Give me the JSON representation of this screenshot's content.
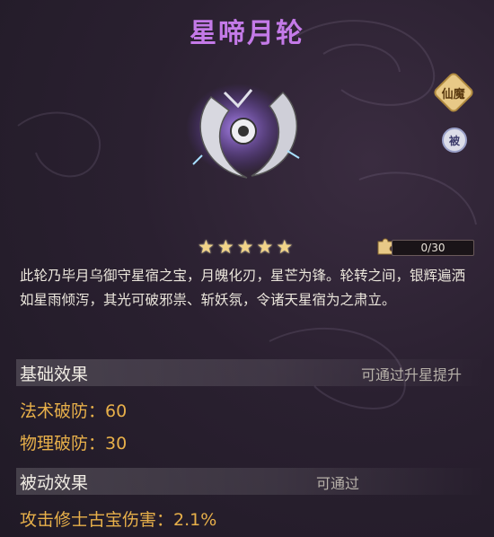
{
  "item": {
    "name": "星啼月轮",
    "tag_type": "仙魔",
    "tag_passive": "被",
    "stars": 5,
    "shards": "0/30",
    "description": "此轮乃毕月乌御守星宿之宝，月魄化刃，星芒为锋。轮转之间，银辉遍洒如星雨倾泻，其光可破邪祟、斩妖氛，令诸天星宿为之肃立。"
  },
  "base_section": {
    "title": "基础效果",
    "hint": "可通过升星提升",
    "stats": [
      "法术破防：60",
      "物理破防：30"
    ]
  },
  "passive_section": {
    "title": "被动效果",
    "hint": "可通过",
    "stats": [
      "攻击修士古宝伤害：2.1%"
    ]
  },
  "colors": {
    "title": "#c47ae8",
    "stat": "#e8b04a",
    "star": "#f2d488"
  },
  "icons": {
    "art": "crescent-blade-wheel-icon",
    "star": "star-icon",
    "shard": "puzzle-piece-icon"
  }
}
